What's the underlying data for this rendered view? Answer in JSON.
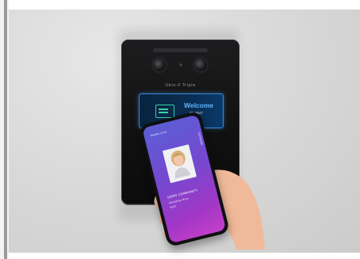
{
  "device": {
    "brand_label": "Ubio-X Triple",
    "screen": {
      "welcome_text": "Welcome",
      "welcome_subtext": "ID: 0047"
    }
  },
  "phone": {
    "header_text": "Mobile Card",
    "side_text": "SUPREMA",
    "id_name": "DEMO COMMUNITY",
    "id_role": "Marketing Team",
    "id_code": "0047"
  }
}
